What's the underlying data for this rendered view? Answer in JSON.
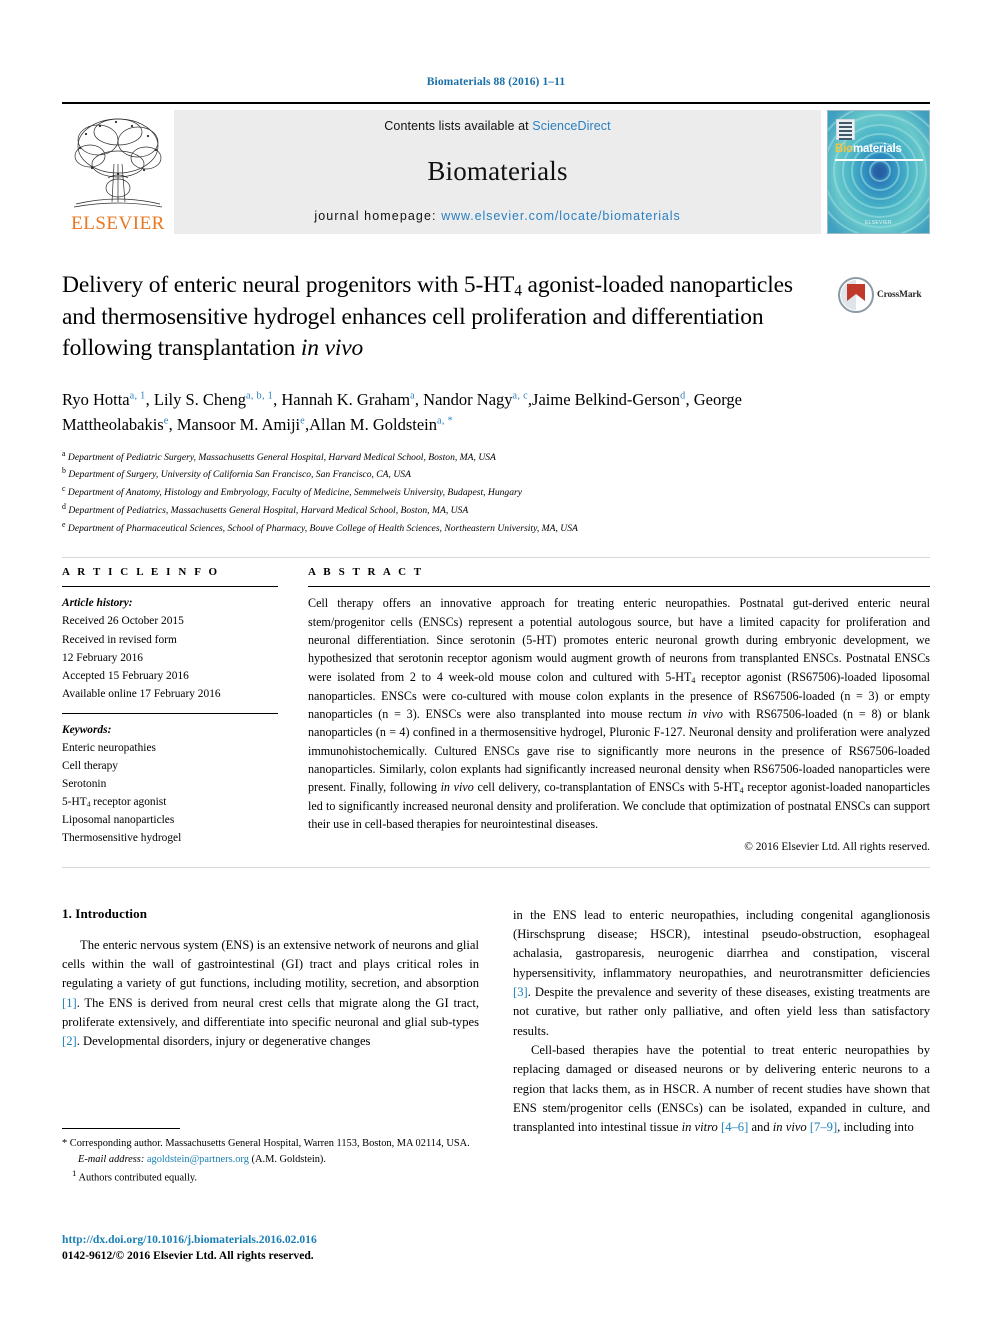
{
  "running_head": "Biomaterials 88 (2016) 1–11",
  "masthead": {
    "publisher": "ELSEVIER",
    "contents_prefix": "Contents lists available at ",
    "contents_link": "ScienceDirect",
    "journal_name": "Biomaterials",
    "homepage_prefix": "journal homepage: ",
    "homepage_url": "www.elsevier.com/locate/biomaterials",
    "cover": {
      "title_first": "Bio",
      "title_rest": "materials",
      "bottom_text": "ELSEVIER"
    }
  },
  "crossmark": {
    "label": "CrossMark"
  },
  "article": {
    "title_line1_a": "Delivery of enteric neural progenitors with 5-HT",
    "title_sub1": "4",
    "title_line1_b": " agonist-loaded",
    "title_line2": "nanoparticles and thermosensitive hydrogel enhances cell",
    "title_line3_a": "proliferation and differentiation following transplantation ",
    "title_line3_italic": "in vivo"
  },
  "authors": [
    {
      "name": "Ryo Hotta",
      "sup": "a, 1",
      "sep": ", "
    },
    {
      "name": "Lily S. Cheng",
      "sup": "a, b, 1",
      "sep": ", "
    },
    {
      "name": "Hannah K. Graham",
      "sup": "a",
      "sep": ", "
    },
    {
      "name": "Nandor Nagy",
      "sup": "a, c",
      "sep": ","
    },
    {
      "name": "Jaime Belkind-Gerson",
      "sup": "d",
      "sep": ", "
    },
    {
      "name": "George Mattheolabakis",
      "sup": "e",
      "sep": ", "
    },
    {
      "name": "Mansoor M. Amiji",
      "sup": "e",
      "sep": ","
    },
    {
      "name": "Allan M. Goldstein",
      "sup": "a, *",
      "sep": ""
    }
  ],
  "affiliations": [
    {
      "mark": "a",
      "text": "Department of Pediatric Surgery, Massachusetts General Hospital, Harvard Medical School, Boston, MA, USA"
    },
    {
      "mark": "b",
      "text": "Department of Surgery, University of California San Francisco, San Francisco, CA, USA"
    },
    {
      "mark": "c",
      "text": "Department of Anatomy, Histology and Embryology, Faculty of Medicine, Semmelweis University, Budapest, Hungary"
    },
    {
      "mark": "d",
      "text": "Department of Pediatrics, Massachusetts General Hospital, Harvard Medical School, Boston, MA, USA"
    },
    {
      "mark": "e",
      "text": "Department of Pharmaceutical Sciences, School of Pharmacy, Bouve College of Health Sciences, Northeastern University, MA, USA"
    }
  ],
  "article_info": {
    "label": "A R T I C L E  I N F O",
    "history_heading": "Article history:",
    "history": [
      "Received 26 October 2015",
      "Received in revised form",
      "12 February 2016",
      "Accepted 15 February 2016",
      "Available online 17 February 2016"
    ],
    "keywords_heading": "Keywords:",
    "keywords": [
      "Enteric neuropathies",
      "Cell therapy",
      "Serotonin",
      "5-HT4 receptor agonist",
      "Liposomal nanoparticles",
      "Thermosensitive hydrogel"
    ],
    "keyword_ht4_prefix": "5-HT",
    "keyword_ht4_sub": "4",
    "keyword_ht4_suffix": " receptor agonist"
  },
  "abstract": {
    "label": "A B S T R A C T",
    "p1": "Cell therapy offers an innovative approach for treating enteric neuropathies. Postnatal gut-derived enteric neural stem/progenitor cells (ENSCs) represent a potential autologous source, but have a limited capacity for proliferation and neuronal differentiation. Since serotonin (5-HT) promotes enteric neuronal growth during embryonic development, we hypothesized that serotonin receptor agonism would augment growth of neurons from transplanted ENSCs. Postnatal ENSCs were isolated from 2 to 4 week-old mouse colon and cultured with 5-HT",
    "p1_sub": "4",
    "p2": " receptor agonist (RS67506)-loaded liposomal nanoparticles. ENSCs were co-cultured with mouse colon explants in the presence of RS67506-loaded (n = 3) or empty nanoparticles (n = 3). ENSCs were also transplanted into mouse rectum ",
    "p2_italic": "in vivo",
    "p3": " with RS67506-loaded (n = 8) or blank nanoparticles (n = 4) confined in a thermosensitive hydrogel, Pluronic F-127. Neuronal density and proliferation were analyzed immunohistochemically. Cultured ENSCs gave rise to significantly more neurons in the presence of RS67506-loaded nanoparticles. Similarly, colon explants had significantly increased neuronal density when RS67506-loaded nanoparticles were present. Finally, following ",
    "p3_italic": "in vivo",
    "p4": " cell delivery, co-transplantation of ENSCs with 5-HT",
    "p4_sub": "4",
    "p5": " receptor agonist-loaded nanoparticles led to significantly increased neuronal density and proliferation. We conclude that optimization of postnatal ENSCs can support their use in cell-based therapies for neurointestinal diseases.",
    "copyright": "© 2016 Elsevier Ltd. All rights reserved."
  },
  "intro": {
    "heading": "1. Introduction",
    "left_p1_a": "The enteric nervous system (ENS) is an extensive network of neurons and glial cells within the wall of gastrointestinal (GI) tract and plays critical roles in regulating a variety of gut functions, including motility, secretion, and absorption ",
    "ref1": "[1]",
    "left_p1_b": ". The ENS is derived from neural crest cells that migrate along the GI tract, proliferate extensively, and differentiate into specific neuronal and glial sub-types ",
    "ref2": "[2]",
    "left_p1_c": ". Developmental disorders, injury or degenerative changes",
    "right_p1_a": "in the ENS lead to enteric neuropathies, including congenital aganglionosis (Hirschsprung disease; HSCR), intestinal pseudo-obstruction, esophageal achalasia, gastroparesis, neurogenic diarrhea and constipation, visceral hypersensitivity, inflammatory neuropathies, and neurotransmitter deficiencies ",
    "ref3": "[3]",
    "right_p1_b": ". Despite the prevalence and severity of these diseases, existing treatments are not curative, but rather only palliative, and often yield less than satisfactory results.",
    "right_p2_a": "Cell-based therapies have the potential to treat enteric neuropathies by replacing damaged or diseased neurons or by delivering enteric neurons to a region that lacks them, as in HSCR. A number of recent studies have shown that ENS stem/progenitor cells (ENSCs) can be isolated, expanded in culture, and transplanted into intestinal tissue ",
    "right_p2_italic1": "in vitro",
    "ref46": "[4–6]",
    "right_p2_b": " and ",
    "right_p2_italic2": "in vivo",
    "ref79": "[7–9]",
    "right_p2_c": ", including into"
  },
  "footnotes": {
    "corresponding": "* Corresponding author. Massachusetts General Hospital, Warren 1153, Boston, MA 02114, USA.",
    "email_label": "E-mail address:",
    "email": "agoldstein@partners.org",
    "email_suffix": "(A.M. Goldstein).",
    "equal_mark": "1",
    "equal_text": "Authors contributed equally."
  },
  "footer": {
    "doi": "http://dx.doi.org/10.1016/j.biomaterials.2016.02.016",
    "issn_line": "0142-9612/© 2016 Elsevier Ltd. All rights reserved."
  },
  "colors": {
    "link": "#1a7fb5",
    "elsevier_orange": "#e87722",
    "masthead_bg": "#ececec"
  }
}
